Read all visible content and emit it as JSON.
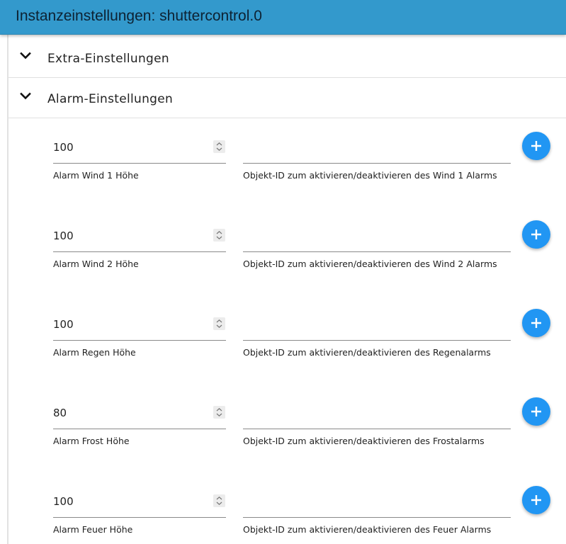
{
  "window": {
    "title": "Instanzeinstellungen: shuttercontrol.0"
  },
  "sections": [
    {
      "label": "Extra-Einstellungen",
      "icon": "chevron-down-icon"
    },
    {
      "label": "Alarm-Einstellungen",
      "icon": "chevron-down-icon"
    }
  ],
  "alarms": [
    {
      "value": "100",
      "label": "Alarm Wind 1 Höhe",
      "id_value": "",
      "id_label": "Objekt-ID zum aktivieren/deaktivieren des Wind 1 Alarms"
    },
    {
      "value": "100",
      "label": "Alarm Wind 2 Höhe",
      "id_value": "",
      "id_label": "Objekt-ID zum aktivieren/deaktivieren des Wind 2 Alarms"
    },
    {
      "value": "100",
      "label": "Alarm Regen Höhe",
      "id_value": "",
      "id_label": "Objekt-ID zum aktivieren/deaktivieren des Regenalarms"
    },
    {
      "value": "80",
      "label": "Alarm Frost Höhe",
      "id_value": "",
      "id_label": "Objekt-ID zum aktivieren/deaktivieren des Frostalarms"
    },
    {
      "value": "100",
      "label": "Alarm Feuer Höhe",
      "id_value": "",
      "id_label": "Objekt-ID zum aktivieren/deaktivieren des Feuer Alarms"
    }
  ],
  "colors": {
    "titlebar": "#3399cc",
    "fab": "#2196f3"
  },
  "icons": {
    "add": "plus-icon",
    "spinner": "spinner-arrows-icon"
  }
}
